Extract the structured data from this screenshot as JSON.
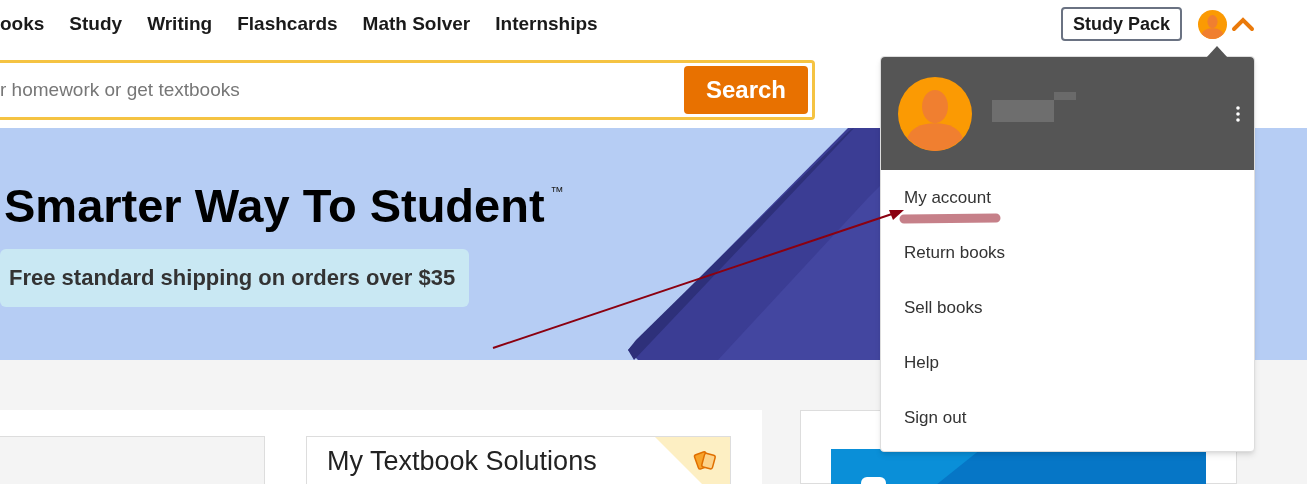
{
  "nav": {
    "links": [
      "ooks",
      "Study",
      "Writing",
      "Flashcards",
      "Math Solver",
      "Internships"
    ],
    "study_pack": "Study Pack",
    "menu_expanded": true
  },
  "search": {
    "placeholder": "r homework or get textbooks",
    "button": "Search"
  },
  "banner": {
    "headline": "Smarter Way To Student",
    "trademark": "™",
    "promo": "Free standard shipping on orders over $35"
  },
  "account_menu": {
    "items": [
      "My account",
      "Return books",
      "Sell books",
      "Help",
      "Sign out"
    ]
  },
  "cards": [
    {
      "title": "My Textbook Solutions"
    }
  ]
}
